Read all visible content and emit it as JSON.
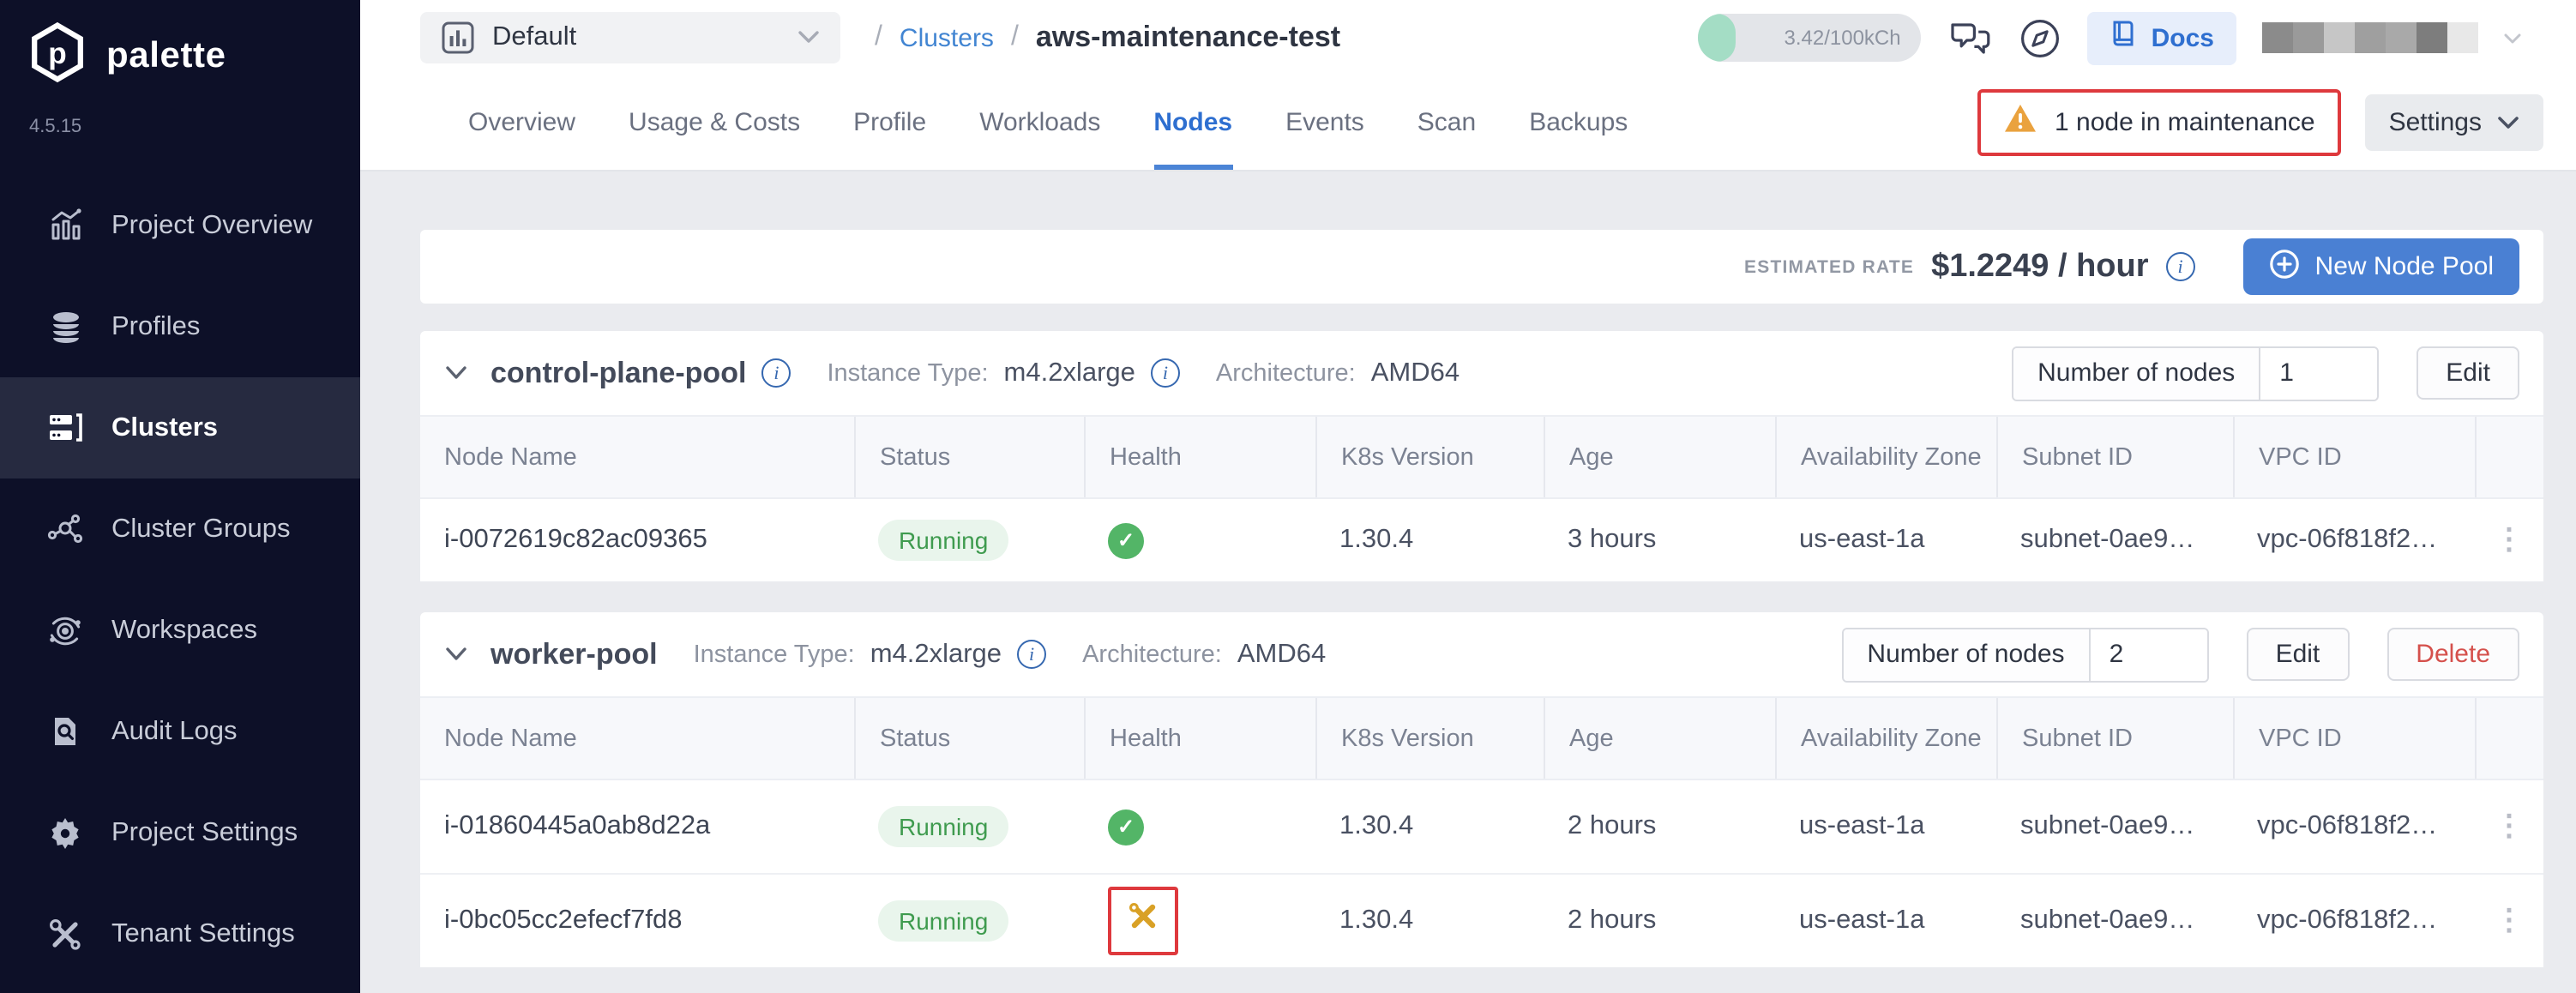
{
  "app": {
    "name": "palette",
    "version": "4.5.15"
  },
  "sidebar": {
    "items": [
      {
        "label": "Project Overview",
        "icon": "bar-chart-icon",
        "active": false
      },
      {
        "label": "Profiles",
        "icon": "layers-icon",
        "active": false
      },
      {
        "label": "Clusters",
        "icon": "server-icon",
        "active": true
      },
      {
        "label": "Cluster Groups",
        "icon": "network-icon",
        "active": false
      },
      {
        "label": "Workspaces",
        "icon": "orbit-icon",
        "active": false
      },
      {
        "label": "Audit Logs",
        "icon": "document-search-icon",
        "active": false
      },
      {
        "label": "Project Settings",
        "icon": "gear-icon",
        "active": false
      },
      {
        "label": "Tenant Settings",
        "icon": "tools-icon",
        "active": false
      }
    ]
  },
  "topbar": {
    "project_selector": {
      "value": "Default",
      "icon": "bar-chart-icon",
      "chevron": "chevron-down-icon"
    },
    "breadcrumb": {
      "separator": "/",
      "link": "Clusters",
      "current": "aws-maintenance-test"
    },
    "usage_badge": {
      "text": "3.42/100kCh"
    },
    "chat_icon": "chat-icon",
    "compass_icon": "compass-icon",
    "docs_button": {
      "label": "Docs",
      "icon": "book-icon"
    },
    "user_block": "redacted-avatar-mosaic"
  },
  "tabs": [
    "Overview",
    "Usage & Costs",
    "Profile",
    "Workloads",
    "Nodes",
    "Events",
    "Scan",
    "Backups"
  ],
  "active_tab": "Nodes",
  "header_actions": {
    "maintenance_alert": "1 node in maintenance",
    "alert_icon": "warning-triangle-icon",
    "settings_button": "Settings"
  },
  "rate_bar": {
    "label": "ESTIMATED RATE",
    "value": "$1.2249 / hour",
    "info_icon": "info-icon",
    "new_node_pool_button": "New Node Pool",
    "new_node_pool_icon": "plus-circle-icon"
  },
  "table": {
    "columns": [
      "Node Name",
      "Status",
      "Health",
      "K8s Version",
      "Age",
      "Availability Zone",
      "Subnet ID",
      "VPC ID"
    ]
  },
  "node_pools": [
    {
      "name": "control-plane-pool",
      "name_info": true,
      "instance_type_label": "Instance Type:",
      "instance_type": "m4.2xlarge",
      "instance_type_info": true,
      "architecture_label": "Architecture:",
      "architecture": "AMD64",
      "nodes_count_label": "Number of nodes",
      "nodes_count": "1",
      "actions": [
        "Edit"
      ],
      "rows": [
        {
          "node_name": "i-0072619c82ac09365",
          "status": "Running",
          "health": "healthy",
          "health_annotated": false,
          "k8s_version": "1.30.4",
          "age": "3 hours",
          "availability_zone": "us-east-1a",
          "subnet_id": "subnet-0ae9…",
          "vpc_id": "vpc-06f818f2…"
        }
      ]
    },
    {
      "name": "worker-pool",
      "name_info": false,
      "instance_type_label": "Instance Type:",
      "instance_type": "m4.2xlarge",
      "instance_type_info": true,
      "architecture_label": "Architecture:",
      "architecture": "AMD64",
      "nodes_count_label": "Number of nodes",
      "nodes_count": "2",
      "actions": [
        "Edit",
        "Delete"
      ],
      "rows": [
        {
          "node_name": "i-01860445a0ab8d22a",
          "status": "Running",
          "health": "healthy",
          "health_annotated": false,
          "k8s_version": "1.30.4",
          "age": "2 hours",
          "availability_zone": "us-east-1a",
          "subnet_id": "subnet-0ae9…",
          "vpc_id": "vpc-06f818f2…"
        },
        {
          "node_name": "i-0bc05cc2efecf7fd8",
          "status": "Running",
          "health": "maintenance",
          "health_annotated": true,
          "k8s_version": "1.30.4",
          "age": "2 hours",
          "availability_zone": "us-east-1a",
          "subnet_id": "subnet-0ae9…",
          "vpc_id": "vpc-06f818f2…"
        }
      ]
    }
  ],
  "colors": {
    "accent_blue": "#4a80d3",
    "link_blue": "#4285d2",
    "active_tab_blue": "#2e6fd0",
    "status_green": "#3f9b4f",
    "health_green": "#53b567",
    "maintenance_gold": "#d9a126",
    "warning_orange": "#eaa23e",
    "annotation_red": "#de393d",
    "delete_red": "#d5504c",
    "sidebar_bg": "#0d1028",
    "sidebar_active_bg": "#262a40",
    "page_bg": "#eaebef"
  }
}
